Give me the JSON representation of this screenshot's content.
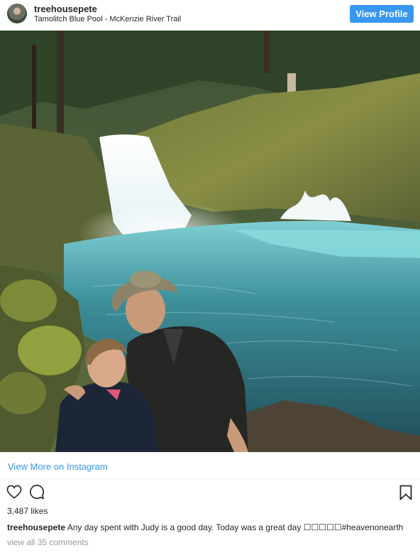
{
  "header": {
    "username": "treehousepete",
    "location": "Tamolitch Blue Pool - McKenzie River Trail",
    "view_profile_label": "View Profile"
  },
  "photo": {
    "description_icon": "waterfall-photo"
  },
  "view_more_label": "View More on Instagram",
  "actions": {
    "like_icon": "heart-icon",
    "comment_icon": "comment-icon",
    "save_icon": "bookmark-icon"
  },
  "likes_text": "3,487 likes",
  "caption": {
    "username": "treehousepete",
    "text": "Any day spent with Judy is a good day. Today was a great day ☐☐☐☐☐#heavenonearth"
  },
  "comments_link": "view all 35 comments",
  "colors": {
    "accent": "#3897f0",
    "text": "#262626",
    "muted": "#999999"
  }
}
